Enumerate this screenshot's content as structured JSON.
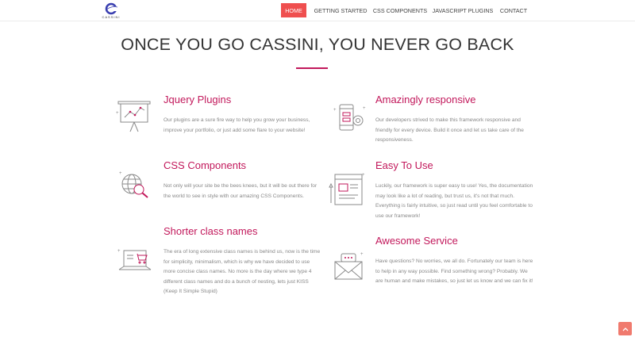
{
  "brand": {
    "logo_text": "CASSINI"
  },
  "nav": {
    "items": [
      {
        "label": "HOME",
        "active": true
      },
      {
        "label": "GETTING STARTED",
        "active": false
      },
      {
        "label": "CSS COMPONENTS",
        "active": false
      },
      {
        "label": "JAVASCRIPT PLUGINS",
        "active": false
      },
      {
        "label": "CONTACT",
        "active": false
      }
    ]
  },
  "hero": {
    "title": "ONCE YOU GO CASSINI, YOU NEVER GO BACK"
  },
  "features": [
    {
      "title": "Jquery Plugins",
      "icon": "presentation-chart-icon",
      "text": "Our plugins are a sure fire way to help you grow your business, improve your portfolio, or just add some flare to your website!"
    },
    {
      "title": "Amazingly responsive",
      "icon": "phone-gear-icon",
      "text": "Our developers strived to make this framework responsive and friendly for every device. Build it once and let us take care of the responsiveness."
    },
    {
      "title": "CSS Components",
      "icon": "globe-magnifier-icon",
      "text": "Not only will your site be the bees knees, but it will be out there for the world to see in style with our amazing CSS Components."
    },
    {
      "title": "Easy To Use",
      "icon": "document-pencil-icon",
      "text": "Luckily, our framework is super easy to use! Yes, the documentation may look like a lot of reading, but trust us, it's not that much. Everything is fairly intuitive, so just read until you feel comfortable to use our framework!"
    },
    {
      "title": "Shorter class names",
      "icon": "laptop-cart-icon",
      "text": "The era of long extensive class names is behind us, now is the time for simplicity, minimalism, which is why we have decided to use more concise class names. No more is the day where we type 4 different class names and do a bunch of nesting, lets just KISS (Keep It Simple Stupid)"
    },
    {
      "title": "Awesome Service",
      "icon": "envelope-chat-icon",
      "text": "Have questions? No worries, we all do. Fortunately our team is here to help in any way possible. Find something wrong? Probably. We are human and make mistakes, so just let us know and we can fix it!"
    }
  ],
  "colors": {
    "accent": "#c2185b",
    "nav_active": "#ef4f4f",
    "scroll_button": "#f07a6e"
  },
  "scroll_top": {
    "icon": "chevron-up-icon"
  }
}
